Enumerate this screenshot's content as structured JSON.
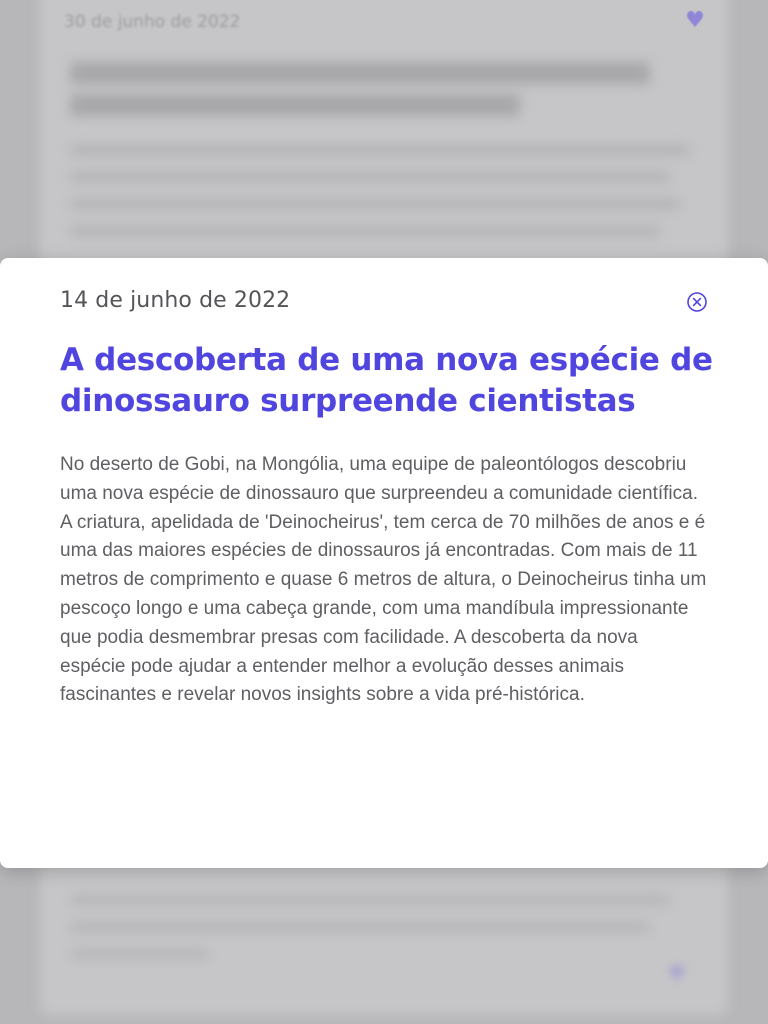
{
  "background": {
    "top_card_date": "30 de junho de 2022",
    "heart_icon": "heart-icon"
  },
  "modal": {
    "date": "14 de junho de 2022",
    "title": "A descoberta de uma nova espécie de dinossauro surpreende cientistas",
    "body": "No deserto de Gobi, na Mongólia, uma equipe de paleontólogos descobriu uma nova espécie de dinossauro que surpreendeu a comunidade científica. A criatura, apelidada de 'Deinocheirus', tem cerca de 70 milhões de anos e é uma das maiores espécies de dinossauros já encontradas. Com mais de 11 metros de comprimento e quase 6 metros de altura, o Deinocheirus tinha um pescoço longo e uma cabeça grande, com uma mandíbula impressionante que podia desmembrar presas com facilidade. A descoberta da nova espécie pode ajudar a entender melhor a evolução desses animais fascinantes e revelar novos insights sobre a vida pré-histórica.",
    "close_icon": "close-circle-icon"
  },
  "colors": {
    "accent": "#5145e0",
    "backdrop": "#b7b7ba",
    "text": "#5f5f63"
  }
}
